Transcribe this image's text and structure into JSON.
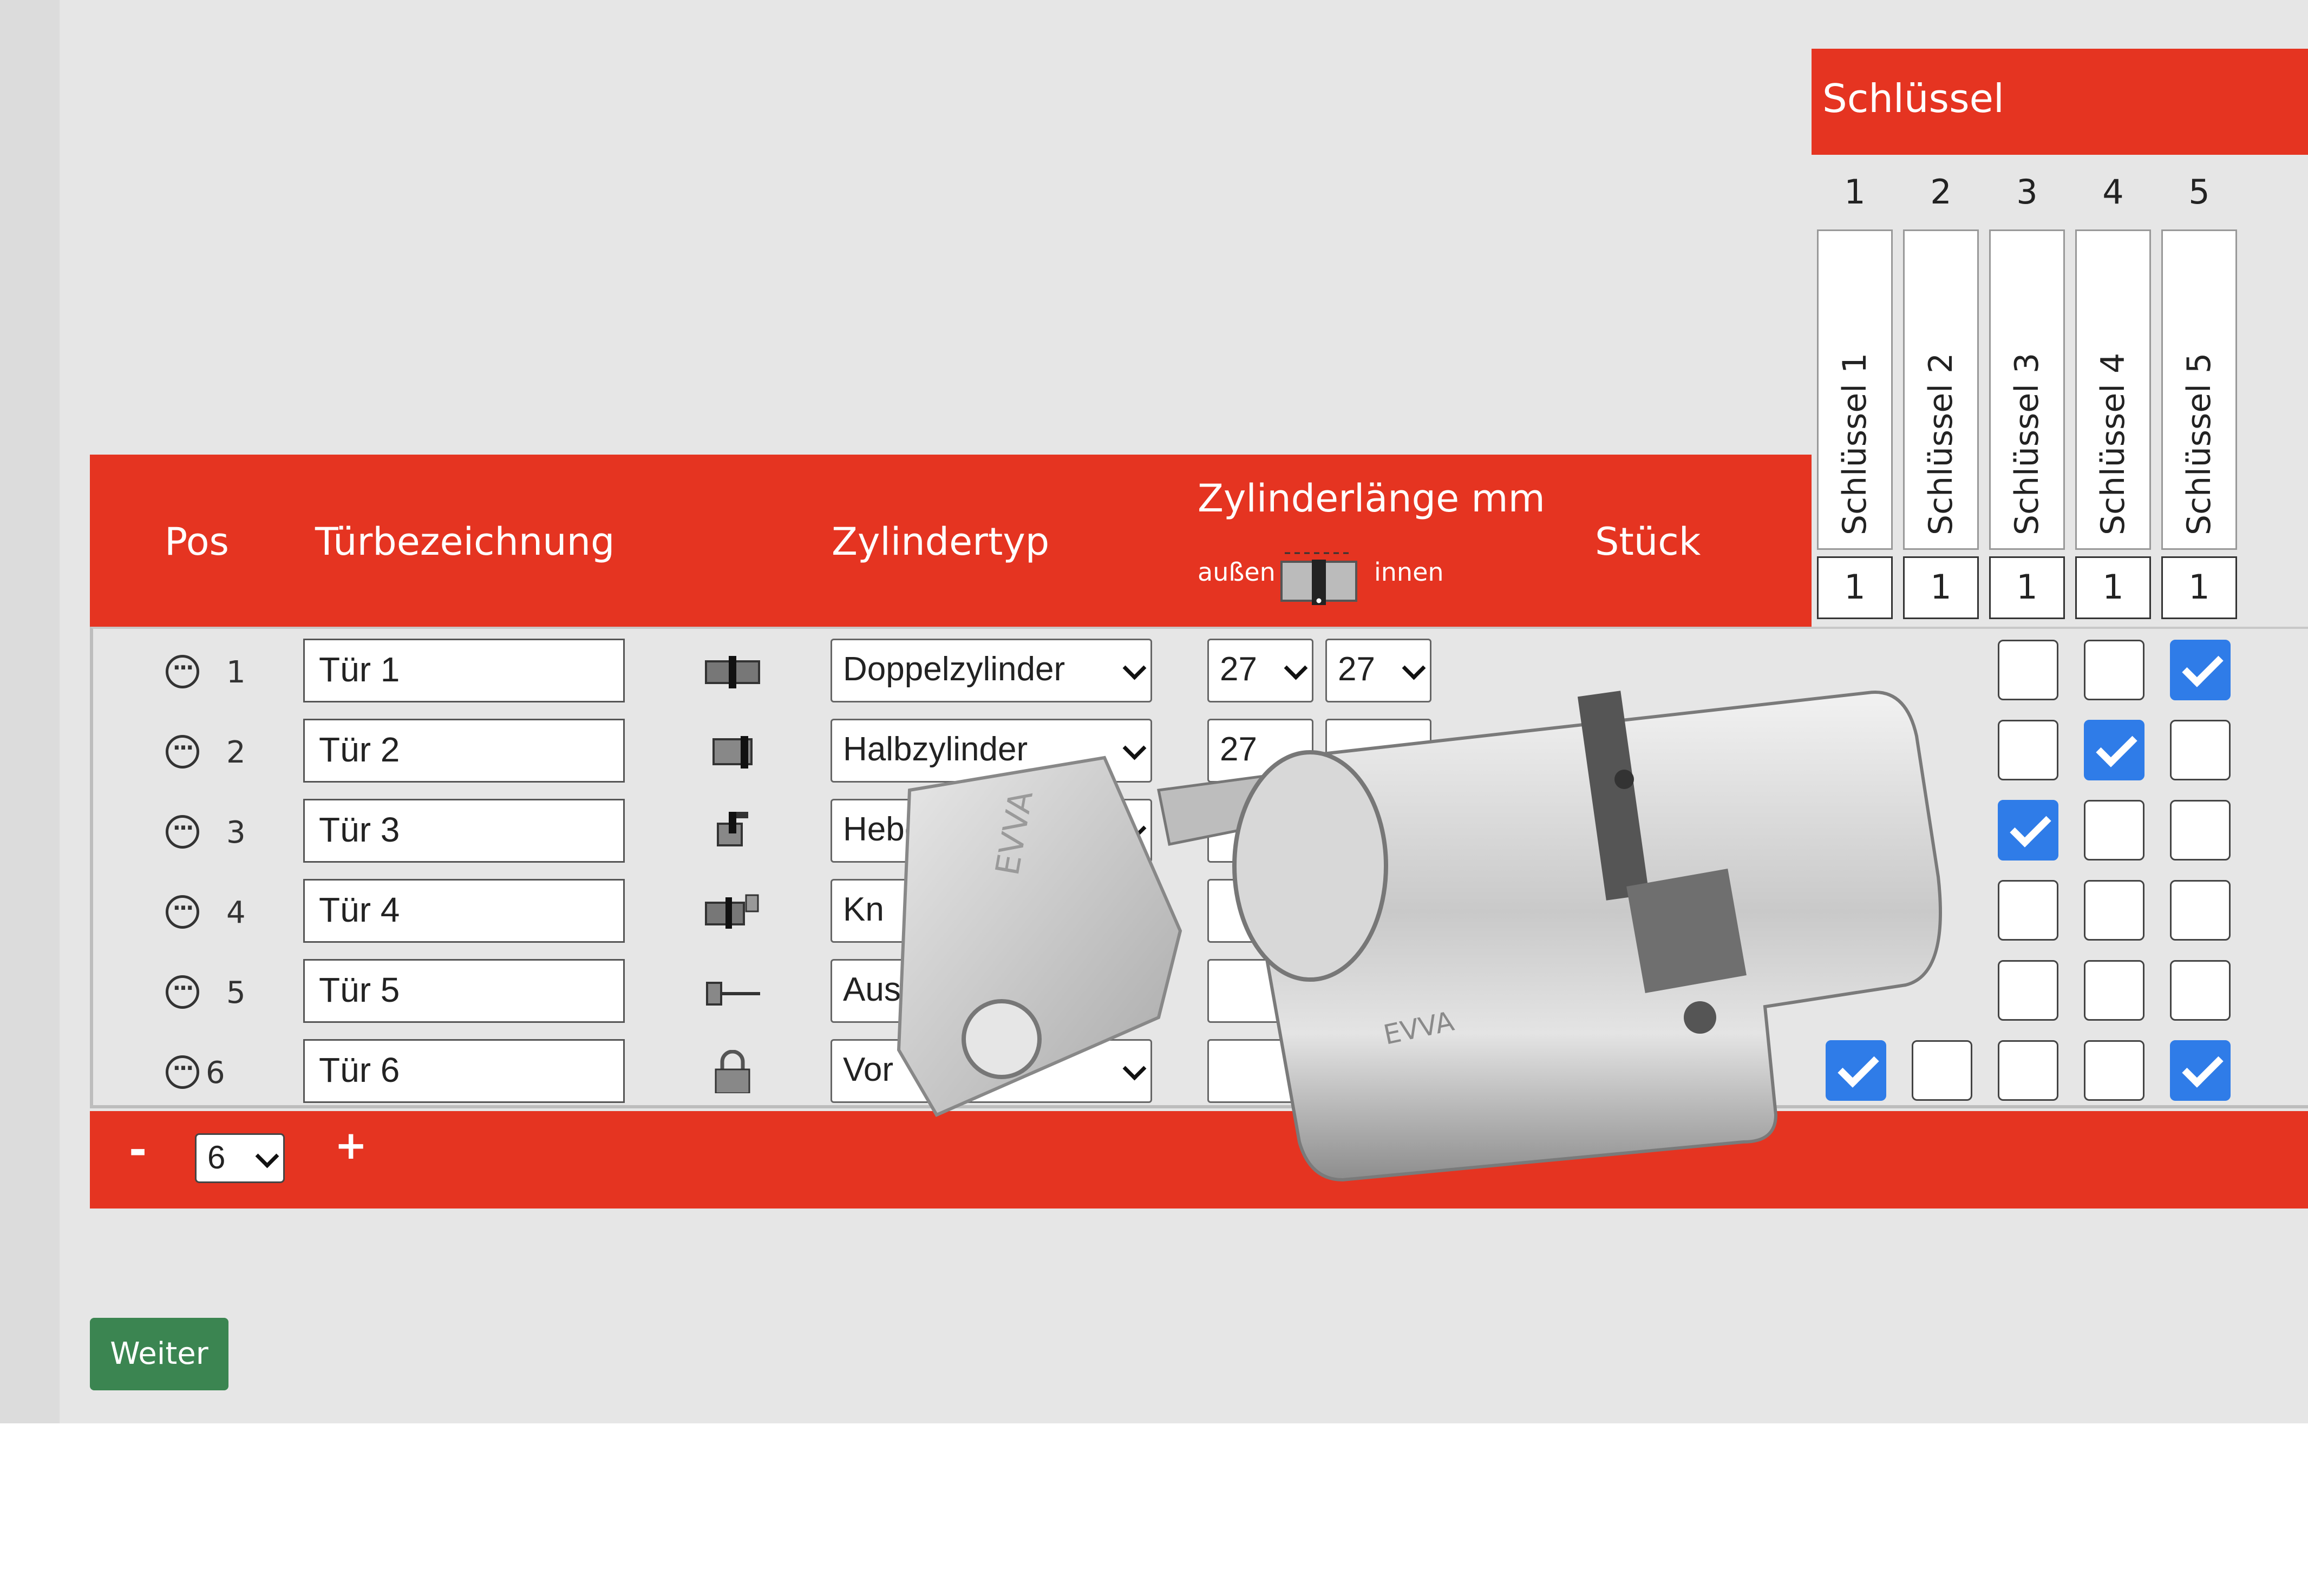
{
  "keys": {
    "title": "Schlüssel",
    "columns": [
      {
        "num": "1",
        "name": "Schlüssel 1",
        "count": "1"
      },
      {
        "num": "2",
        "name": "Schlüssel 2",
        "count": "1"
      },
      {
        "num": "3",
        "name": "Schlüssel 3",
        "count": "1"
      },
      {
        "num": "4",
        "name": "Schlüssel 4",
        "count": "1"
      },
      {
        "num": "5",
        "name": "Schlüssel 5",
        "count": "1"
      }
    ]
  },
  "table": {
    "headers": {
      "pos": "Pos",
      "door": "Türbezeichnung",
      "type": "Zylindertyp",
      "length": "Zylinderlänge mm",
      "outside": "außen",
      "inside": "innen",
      "qty": "Stück"
    },
    "rows": [
      {
        "pos": "1",
        "door": "Tür 1",
        "type": "Doppelzylinder",
        "icon": "double-cylinder-icon",
        "outside": "27",
        "inside": "27",
        "keys": [
          null,
          null,
          false,
          false,
          true
        ]
      },
      {
        "pos": "2",
        "door": "Tür 2",
        "type": "Halbzylinder",
        "icon": "half-cylinder-icon",
        "outside": "27",
        "inside": "",
        "keys": [
          null,
          null,
          false,
          true,
          false
        ]
      },
      {
        "pos": "3",
        "door": "Tür 3",
        "type": "Hebe",
        "icon": "lever-cylinder-icon",
        "outside": "",
        "inside": "",
        "keys": [
          null,
          null,
          true,
          false,
          false
        ]
      },
      {
        "pos": "4",
        "door": "Tür 4",
        "type": "Kn",
        "icon": "knob-cylinder-icon",
        "outside": "",
        "inside": "",
        "keys": [
          null,
          null,
          false,
          false,
          false
        ]
      },
      {
        "pos": "5",
        "door": "Tür 5",
        "type": "Aus",
        "icon": "external-cylinder-icon",
        "outside": "",
        "inside": "",
        "keys": [
          null,
          null,
          false,
          false,
          false
        ]
      },
      {
        "pos": "6",
        "door": "Tür 6",
        "type": "Vor",
        "icon": "padlock-icon",
        "outside": "",
        "inside": "",
        "keys": [
          true,
          false,
          false,
          false,
          true
        ]
      }
    ]
  },
  "footer": {
    "minus": "-",
    "count": "6",
    "plus": "+"
  },
  "next_button": "Weiter",
  "image_labels": {
    "brand_key": "EVVA",
    "brand_cylinder": "EVVA"
  }
}
